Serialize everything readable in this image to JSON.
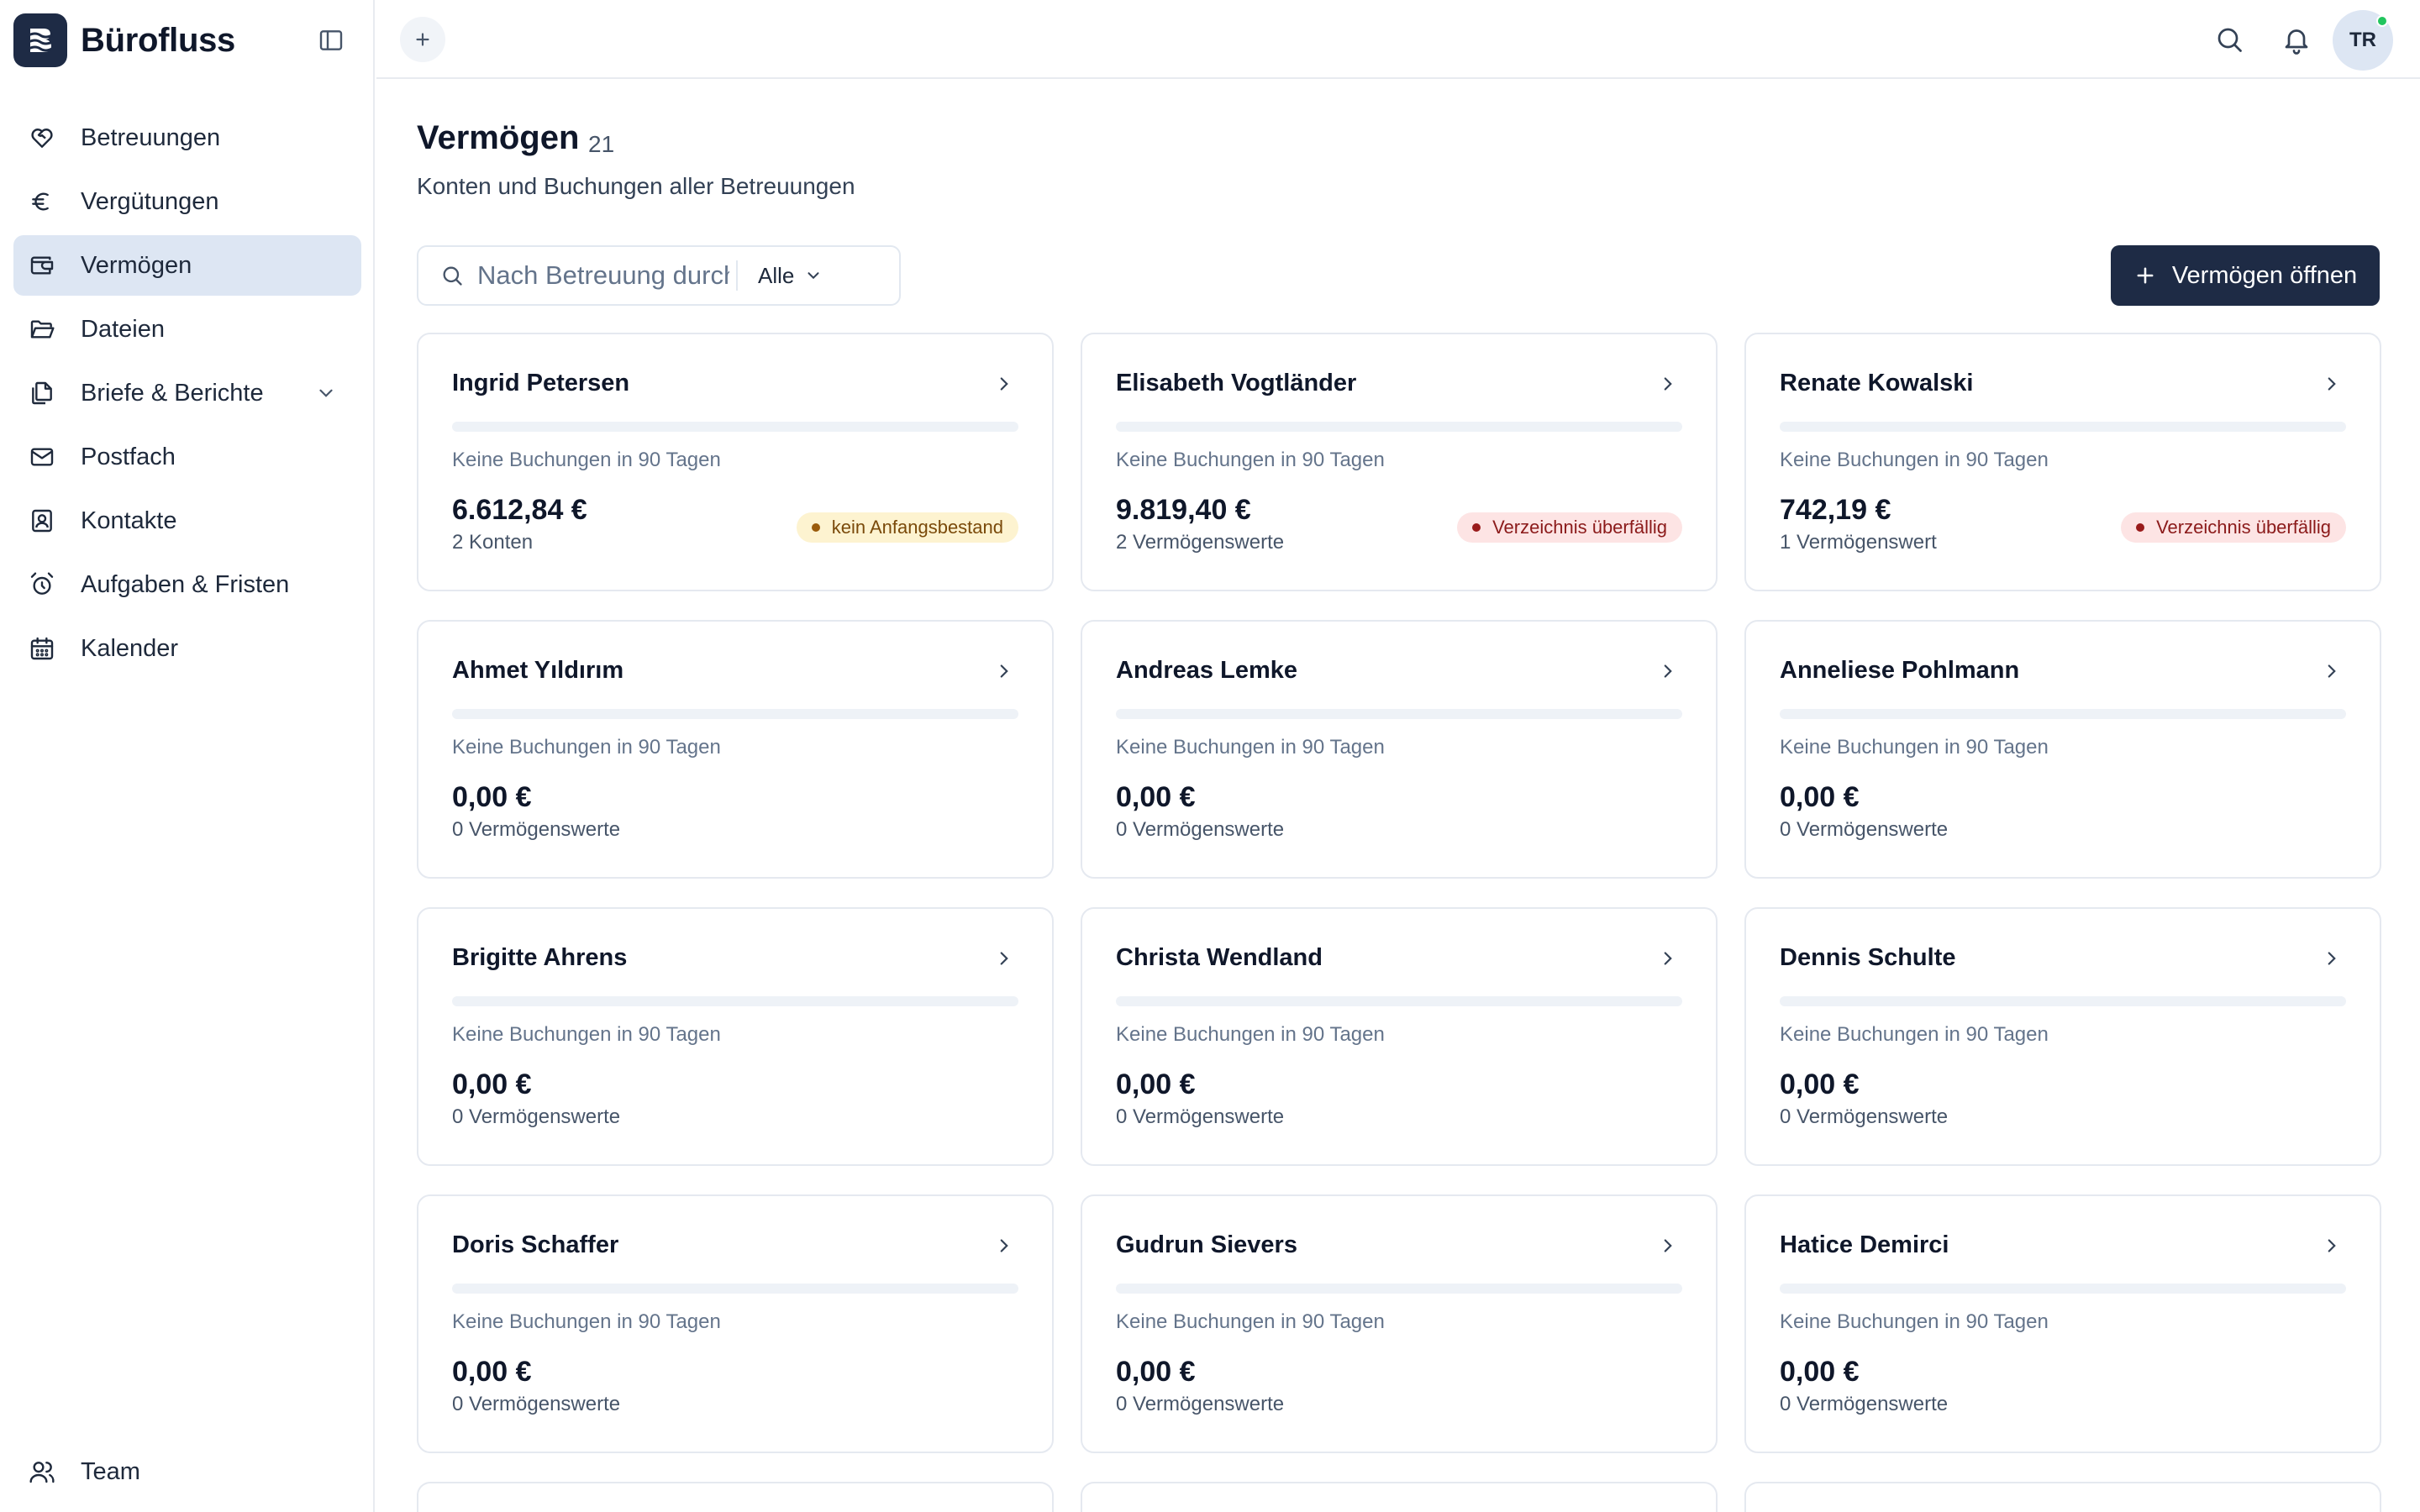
{
  "app": {
    "name": "Bürofluss"
  },
  "sidebar": {
    "items": [
      {
        "label": "Betreuungen",
        "icon": "heart-handshake-icon",
        "active": false
      },
      {
        "label": "Vergütungen",
        "icon": "euro-icon",
        "active": false
      },
      {
        "label": "Vermögen",
        "icon": "wallet-icon",
        "active": true
      },
      {
        "label": "Dateien",
        "icon": "folder-icon",
        "active": false
      },
      {
        "label": "Briefe & Berichte",
        "icon": "files-icon",
        "active": false,
        "expandable": true
      },
      {
        "label": "Postfach",
        "icon": "mail-icon",
        "active": false
      },
      {
        "label": "Kontakte",
        "icon": "contact-icon",
        "active": false
      },
      {
        "label": "Aufgaben & Fristen",
        "icon": "alarm-clock-icon",
        "active": false
      },
      {
        "label": "Kalender",
        "icon": "calendar-icon",
        "active": false
      }
    ],
    "team": {
      "label": "Team",
      "icon": "users-icon"
    }
  },
  "topbar": {
    "avatar_initials": "TR",
    "icons": [
      "plus-icon",
      "search-icon",
      "bell-icon"
    ]
  },
  "page": {
    "title": "Vermögen",
    "count": "21",
    "subtitle": "Konten und Buchungen aller Betreuungen"
  },
  "toolbar": {
    "search_placeholder": "Nach Betreuung durchsuchen",
    "filter_value": "Alle",
    "open_button_label": "Vermögen öffnen"
  },
  "colors": {
    "primary": "#1e2b45",
    "active_nav": "#dde6f3",
    "warn_bg": "#fdf3d0",
    "danger_bg": "#fde4e4",
    "online": "#22c55e"
  },
  "cards": [
    {
      "name": "Ingrid Petersen",
      "note": "Keine Buchungen in 90 Tagen",
      "amount": "6.612,84 €",
      "meta": "2 Konten",
      "badge": {
        "label": "kein Anfangsbestand",
        "kind": "warn"
      }
    },
    {
      "name": "Elisabeth Vogtländer",
      "note": "Keine Buchungen in 90 Tagen",
      "amount": "9.819,40 €",
      "meta": "2 Vermögenswerte",
      "badge": {
        "label": "Verzeichnis überfällig",
        "kind": "danger"
      }
    },
    {
      "name": "Renate Kowalski",
      "note": "Keine Buchungen in 90 Tagen",
      "amount": "742,19 €",
      "meta": "1 Vermögenswert",
      "badge": {
        "label": "Verzeichnis überfällig",
        "kind": "danger"
      }
    },
    {
      "name": "Ahmet Yıldırım",
      "note": "Keine Buchungen in 90 Tagen",
      "amount": "0,00 €",
      "meta": "0 Vermögenswerte"
    },
    {
      "name": "Andreas Lemke",
      "note": "Keine Buchungen in 90 Tagen",
      "amount": "0,00 €",
      "meta": "0 Vermögenswerte"
    },
    {
      "name": "Anneliese Pohlmann",
      "note": "Keine Buchungen in 90 Tagen",
      "amount": "0,00 €",
      "meta": "0 Vermögenswerte"
    },
    {
      "name": "Brigitte Ahrens",
      "note": "Keine Buchungen in 90 Tagen",
      "amount": "0,00 €",
      "meta": "0 Vermögenswerte"
    },
    {
      "name": "Christa Wendland",
      "note": "Keine Buchungen in 90 Tagen",
      "amount": "0,00 €",
      "meta": "0 Vermögenswerte"
    },
    {
      "name": "Dennis Schulte",
      "note": "Keine Buchungen in 90 Tagen",
      "amount": "0,00 €",
      "meta": "0 Vermögenswerte"
    },
    {
      "name": "Doris Schaffer",
      "note": "Keine Buchungen in 90 Tagen",
      "amount": "0,00 €",
      "meta": "0 Vermögenswerte"
    },
    {
      "name": "Gudrun Sievers",
      "note": "Keine Buchungen in 90 Tagen",
      "amount": "0,00 €",
      "meta": "0 Vermögenswerte"
    },
    {
      "name": "Hatice Demirci",
      "note": "Keine Buchungen in 90 Tagen",
      "amount": "0,00 €",
      "meta": "0 Vermögenswerte"
    }
  ]
}
